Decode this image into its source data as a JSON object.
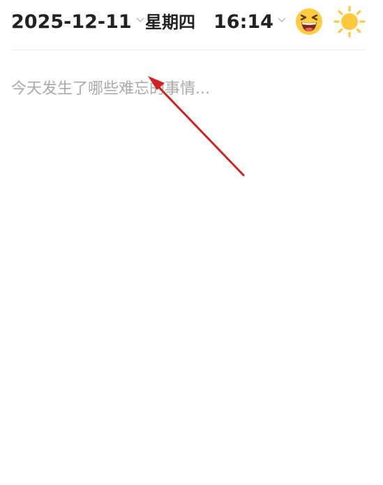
{
  "header": {
    "date": "2025-12-11",
    "weekday": "星期四",
    "time": "16:14",
    "mood_icon": "laughing-face-icon",
    "weather_icon": "sunny-icon"
  },
  "editor": {
    "placeholder": "今天发生了哪些难忘的事情..."
  },
  "colors": {
    "text": "#222222",
    "placeholder": "#a9a9a9",
    "divider": "#eeeeee",
    "chevron": "#bbbbbb",
    "emoji_face": "#ffcc3d",
    "sun": "#ffc83a",
    "annotation_arrow": "#d42020"
  }
}
